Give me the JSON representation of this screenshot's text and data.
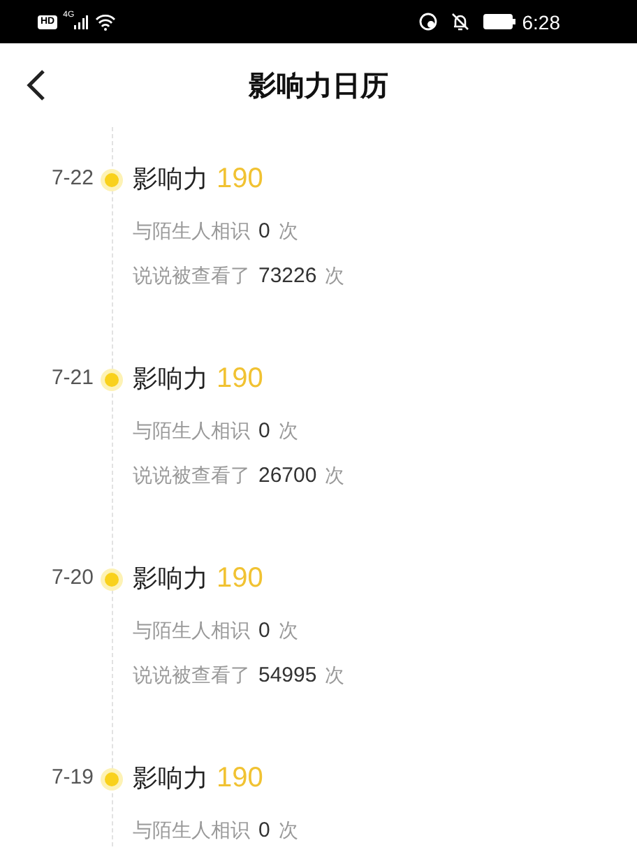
{
  "status_bar": {
    "hd": "HD",
    "network": "4G",
    "time": "6:28"
  },
  "header": {
    "title": "影响力日历"
  },
  "entries": [
    {
      "date": "7-22",
      "label": "影响力",
      "score": "190",
      "stats": [
        {
          "label": "与陌生人相识",
          "value": "0",
          "unit": "次"
        },
        {
          "label": "说说被查看了",
          "value": "73226",
          "unit": "次"
        }
      ]
    },
    {
      "date": "7-21",
      "label": "影响力",
      "score": "190",
      "stats": [
        {
          "label": "与陌生人相识",
          "value": "0",
          "unit": "次"
        },
        {
          "label": "说说被查看了",
          "value": "26700",
          "unit": "次"
        }
      ]
    },
    {
      "date": "7-20",
      "label": "影响力",
      "score": "190",
      "stats": [
        {
          "label": "与陌生人相识",
          "value": "0",
          "unit": "次"
        },
        {
          "label": "说说被查看了",
          "value": "54995",
          "unit": "次"
        }
      ]
    },
    {
      "date": "7-19",
      "label": "影响力",
      "score": "190",
      "stats": [
        {
          "label": "与陌生人相识",
          "value": "0",
          "unit": "次"
        }
      ]
    }
  ]
}
